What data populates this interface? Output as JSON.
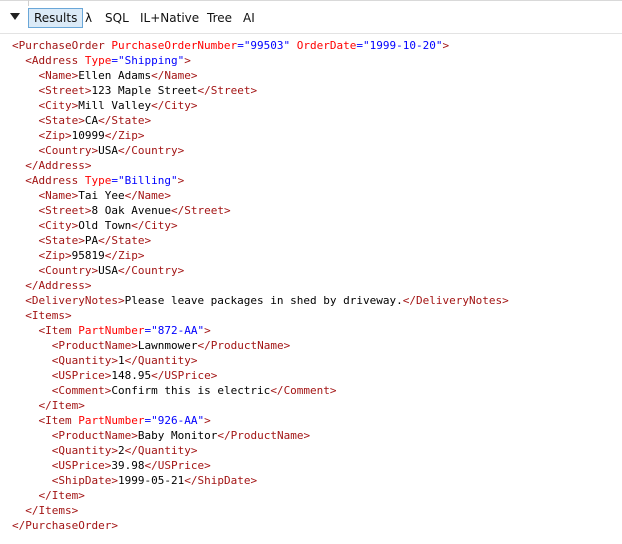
{
  "toolbar": {
    "tabs": [
      {
        "label": "Results",
        "active": true
      },
      {
        "label": "λ",
        "active": false
      },
      {
        "label": "SQL",
        "active": false
      },
      {
        "label": "IL+Native",
        "active": false
      },
      {
        "label": "Tree",
        "active": false
      },
      {
        "label": "AI",
        "active": false
      }
    ]
  },
  "colors": {
    "tag": "#a31515",
    "attribute_name": "#ff0000",
    "attribute_value": "#0000ff",
    "text": "#000000",
    "active_tab_bg": "#dbeaf7",
    "active_tab_border": "#6aa7d8"
  },
  "xml": [
    {
      "indent": 0,
      "type": "open",
      "name": "PurchaseOrder",
      "attrs": [
        {
          "name": "PurchaseOrderNumber",
          "value": "\"99503\""
        },
        {
          "name": "OrderDate",
          "value": "\"1999-10-20\""
        }
      ]
    },
    {
      "indent": 1,
      "type": "open",
      "name": "Address",
      "attrs": [
        {
          "name": "Type",
          "value": "\"Shipping\""
        }
      ]
    },
    {
      "indent": 2,
      "type": "leaf",
      "name": "Name",
      "text": "Ellen Adams"
    },
    {
      "indent": 2,
      "type": "leaf",
      "name": "Street",
      "text": "123 Maple Street"
    },
    {
      "indent": 2,
      "type": "leaf",
      "name": "City",
      "text": "Mill Valley"
    },
    {
      "indent": 2,
      "type": "leaf",
      "name": "State",
      "text": "CA"
    },
    {
      "indent": 2,
      "type": "leaf",
      "name": "Zip",
      "text": "10999"
    },
    {
      "indent": 2,
      "type": "leaf",
      "name": "Country",
      "text": "USA"
    },
    {
      "indent": 1,
      "type": "close",
      "name": "Address"
    },
    {
      "indent": 1,
      "type": "open",
      "name": "Address",
      "attrs": [
        {
          "name": "Type",
          "value": "\"Billing\""
        }
      ]
    },
    {
      "indent": 2,
      "type": "leaf",
      "name": "Name",
      "text": "Tai Yee"
    },
    {
      "indent": 2,
      "type": "leaf",
      "name": "Street",
      "text": "8 Oak Avenue"
    },
    {
      "indent": 2,
      "type": "leaf",
      "name": "City",
      "text": "Old Town"
    },
    {
      "indent": 2,
      "type": "leaf",
      "name": "State",
      "text": "PA"
    },
    {
      "indent": 2,
      "type": "leaf",
      "name": "Zip",
      "text": "95819"
    },
    {
      "indent": 2,
      "type": "leaf",
      "name": "Country",
      "text": "USA"
    },
    {
      "indent": 1,
      "type": "close",
      "name": "Address"
    },
    {
      "indent": 1,
      "type": "leaf",
      "name": "DeliveryNotes",
      "text": "Please leave packages in shed by driveway."
    },
    {
      "indent": 1,
      "type": "open",
      "name": "Items",
      "attrs": []
    },
    {
      "indent": 2,
      "type": "open",
      "name": "Item",
      "attrs": [
        {
          "name": "PartNumber",
          "value": "\"872-AA\""
        }
      ]
    },
    {
      "indent": 3,
      "type": "leaf",
      "name": "ProductName",
      "text": "Lawnmower"
    },
    {
      "indent": 3,
      "type": "leaf",
      "name": "Quantity",
      "text": "1"
    },
    {
      "indent": 3,
      "type": "leaf",
      "name": "USPrice",
      "text": "148.95"
    },
    {
      "indent": 3,
      "type": "leaf",
      "name": "Comment",
      "text": "Confirm this is electric"
    },
    {
      "indent": 2,
      "type": "close",
      "name": "Item"
    },
    {
      "indent": 2,
      "type": "open",
      "name": "Item",
      "attrs": [
        {
          "name": "PartNumber",
          "value": "\"926-AA\""
        }
      ]
    },
    {
      "indent": 3,
      "type": "leaf",
      "name": "ProductName",
      "text": "Baby Monitor"
    },
    {
      "indent": 3,
      "type": "leaf",
      "name": "Quantity",
      "text": "2"
    },
    {
      "indent": 3,
      "type": "leaf",
      "name": "USPrice",
      "text": "39.98"
    },
    {
      "indent": 3,
      "type": "leaf",
      "name": "ShipDate",
      "text": "1999-05-21"
    },
    {
      "indent": 2,
      "type": "close",
      "name": "Item"
    },
    {
      "indent": 1,
      "type": "close",
      "name": "Items"
    },
    {
      "indent": 0,
      "type": "close",
      "name": "PurchaseOrder"
    }
  ]
}
